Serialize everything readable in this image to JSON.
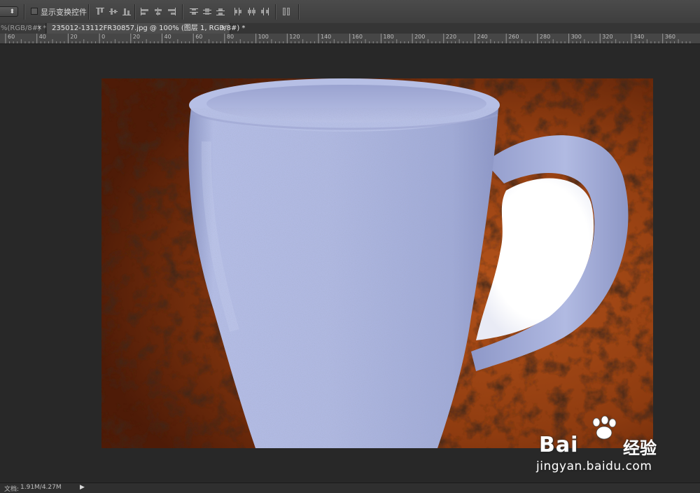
{
  "options_bar": {
    "dropdown_icon": "updown-arrows-icon",
    "dropdown_glyph": "⬍",
    "show_transform_controls_label": "显示变换控件",
    "show_transform_controls_checked": false,
    "align_icons": [
      "align-top-edges-icon",
      "align-vertical-centers-icon",
      "align-bottom-edges-icon",
      "align-left-edges-icon",
      "align-horizontal-centers-icon",
      "align-right-edges-icon",
      "distribute-top-icon",
      "distribute-vcenter-icon",
      "distribute-bottom-icon",
      "distribute-left-icon",
      "distribute-hcenter-icon",
      "distribute-right-icon",
      "auto-align-layers-icon"
    ]
  },
  "tabs": [
    {
      "label": "%(RGB/8#) *",
      "close": "×",
      "active": false
    },
    {
      "label": "235012-13112FR30857.jpg @ 100% (图层 1, RGB/8#) *",
      "close": "×",
      "active": true
    }
  ],
  "ruler": {
    "labels": [
      "60",
      "40",
      "20",
      "0",
      "20",
      "40",
      "60",
      "80",
      "100",
      "120",
      "140",
      "160",
      "180",
      "200",
      "220",
      "240",
      "260",
      "280",
      "300",
      "320",
      "340",
      "360"
    ]
  },
  "canvas": {
    "background_color": "#282828",
    "image_description_icon": "mug-on-leather-image",
    "leather_color": "#8a3a0e",
    "mug_color": "#a9b3dc"
  },
  "status_bar": {
    "doc_label": "文档:",
    "doc_value": "1.91M/4.27M",
    "arrow": "▶"
  },
  "watermark": {
    "brand": "Bai",
    "brand_suffix": "经验",
    "url": "jingyan.baidu.com"
  }
}
